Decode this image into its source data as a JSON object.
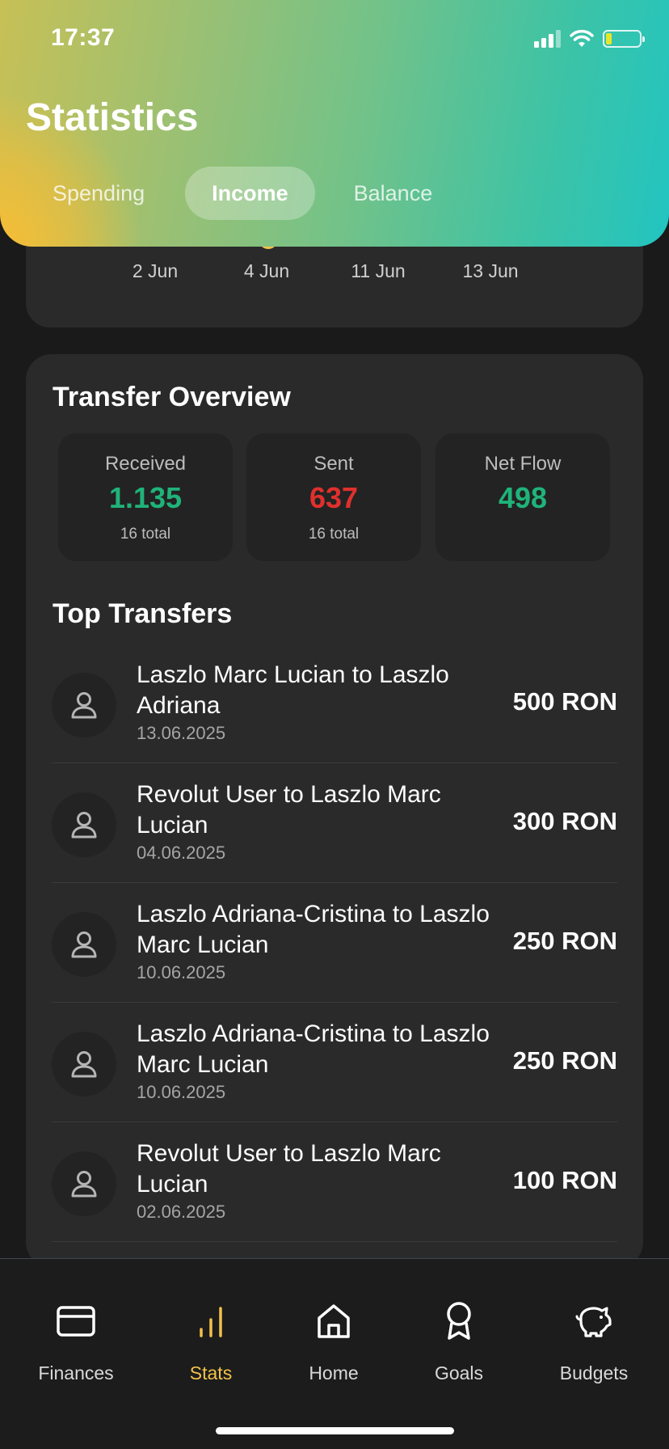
{
  "status_bar": {
    "time": "17:37"
  },
  "header": {
    "title": "Statistics",
    "tabs": [
      {
        "label": "Spending",
        "active": false
      },
      {
        "label": "Income",
        "active": true
      },
      {
        "label": "Balance",
        "active": false
      }
    ]
  },
  "chart": {
    "x_labels": [
      "2 Jun",
      "4 Jun",
      "11 Jun",
      "13 Jun"
    ]
  },
  "overview": {
    "title": "Transfer Overview",
    "received": {
      "label": "Received",
      "value": "1.135",
      "sub": "16 total",
      "color": "#1fb37a"
    },
    "sent": {
      "label": "Sent",
      "value": "637",
      "sub": "16 total",
      "color": "#e0302d"
    },
    "net_flow": {
      "label": "Net Flow",
      "value": "498",
      "color": "#1fb37a"
    }
  },
  "top_transfers": {
    "title": "Top Transfers",
    "items": [
      {
        "name": "Laszlo Marc Lucian to Laszlo Adriana",
        "date": "13.06.2025",
        "amount": "500 RON"
      },
      {
        "name": "Revolut User to Laszlo Marc Lucian",
        "date": "04.06.2025",
        "amount": "300 RON"
      },
      {
        "name": "Laszlo Adriana-Cristina to Laszlo Marc Lucian",
        "date": "10.06.2025",
        "amount": "250 RON"
      },
      {
        "name": "Laszlo Adriana-Cristina to Laszlo Marc Lucian",
        "date": "10.06.2025",
        "amount": "250 RON"
      },
      {
        "name": "Revolut User to Laszlo Marc Lucian",
        "date": "02.06.2025",
        "amount": "100 RON"
      }
    ]
  },
  "nav": {
    "accent": "#f2c14b",
    "items": [
      {
        "label": "Finances",
        "icon": "card-icon",
        "active": false
      },
      {
        "label": "Stats",
        "icon": "stats-icon",
        "active": true
      },
      {
        "label": "Home",
        "icon": "home-icon",
        "active": false
      },
      {
        "label": "Goals",
        "icon": "award-icon",
        "active": false
      },
      {
        "label": "Budgets",
        "icon": "piggy-bank-icon",
        "active": false
      }
    ]
  }
}
